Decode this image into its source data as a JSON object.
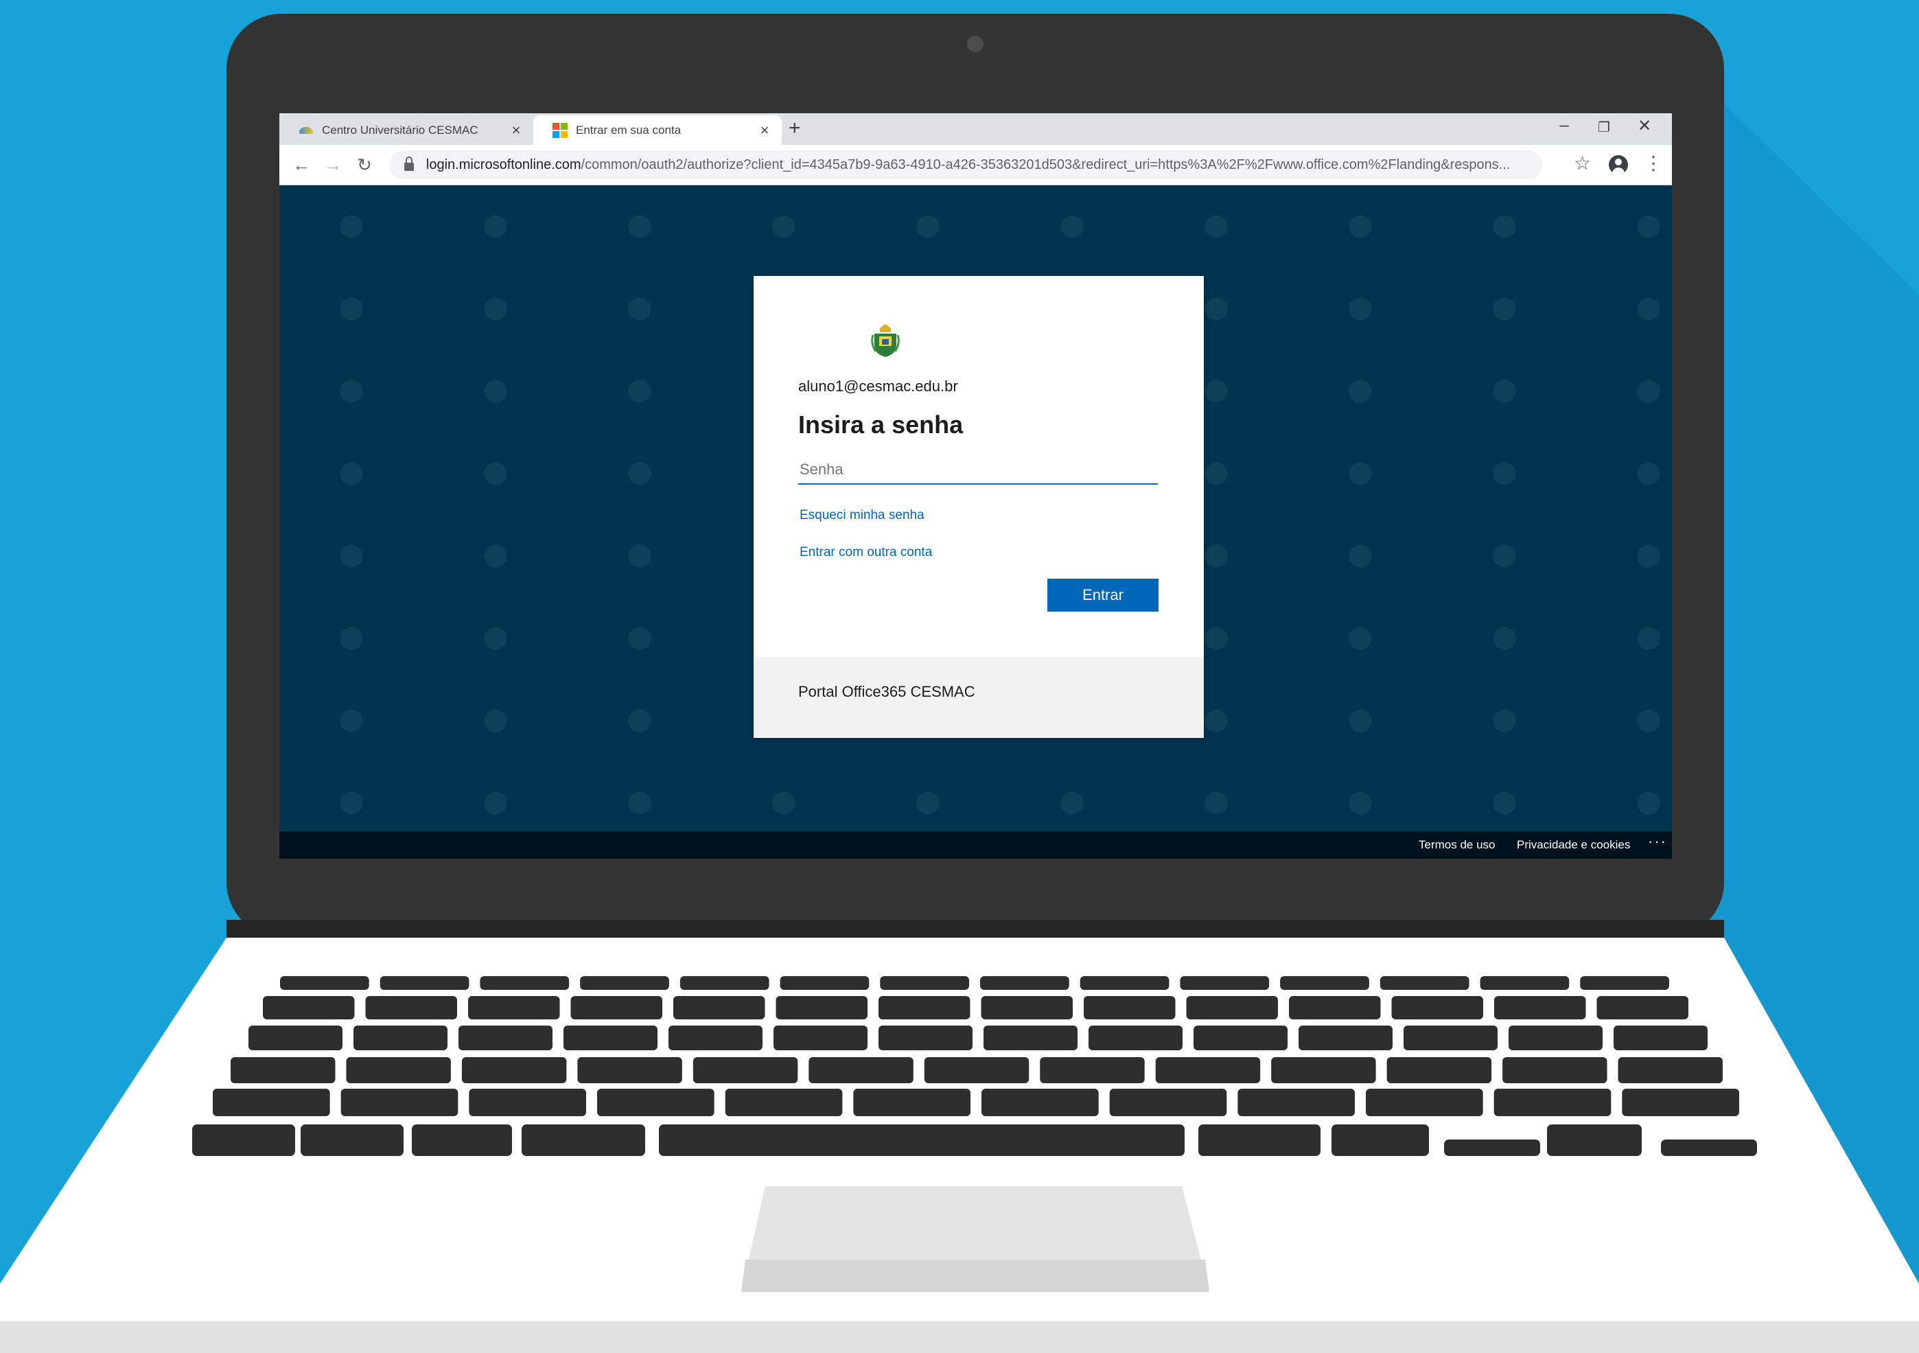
{
  "browser": {
    "tabs": [
      {
        "title": "Centro Universitário CESMAC",
        "active": false,
        "icon": "cesmac-favicon-icon"
      },
      {
        "title": "Entrar em sua conta",
        "active": true,
        "icon": "microsoft-favicon-icon"
      }
    ],
    "new_tab_label": "+",
    "window_controls": {
      "minimize": "–",
      "restore": "❐",
      "close": "✕"
    },
    "nav": {
      "back": "←",
      "forward": "→",
      "reload": "↻"
    },
    "url_host": "login.microsoftonline.com",
    "url_rest": "/common/oauth2/authorize?client_id=4345a7b9-9a63-4910-a426-35363201d503&redirect_uri=https%3A%2F%2Fwww.office.com%2Flanding&respons...",
    "bookmark_icon": "☆",
    "menu_icon": "⋮"
  },
  "login": {
    "account": "aluno1@cesmac.edu.br",
    "heading": "Insira a senha",
    "password_placeholder": "Senha",
    "forgot_link": "Esqueci minha senha",
    "other_account_link": "Entrar com outra conta",
    "submit_label": "Entrar",
    "org_footer": "Portal Office365 CESMAC"
  },
  "page_footer": {
    "terms": "Termos de uso",
    "privacy": "Privacidade e cookies",
    "more": "···"
  },
  "colors": {
    "background": "#18a3d8",
    "page_background": "#00344f",
    "accent": "#0067b8"
  }
}
